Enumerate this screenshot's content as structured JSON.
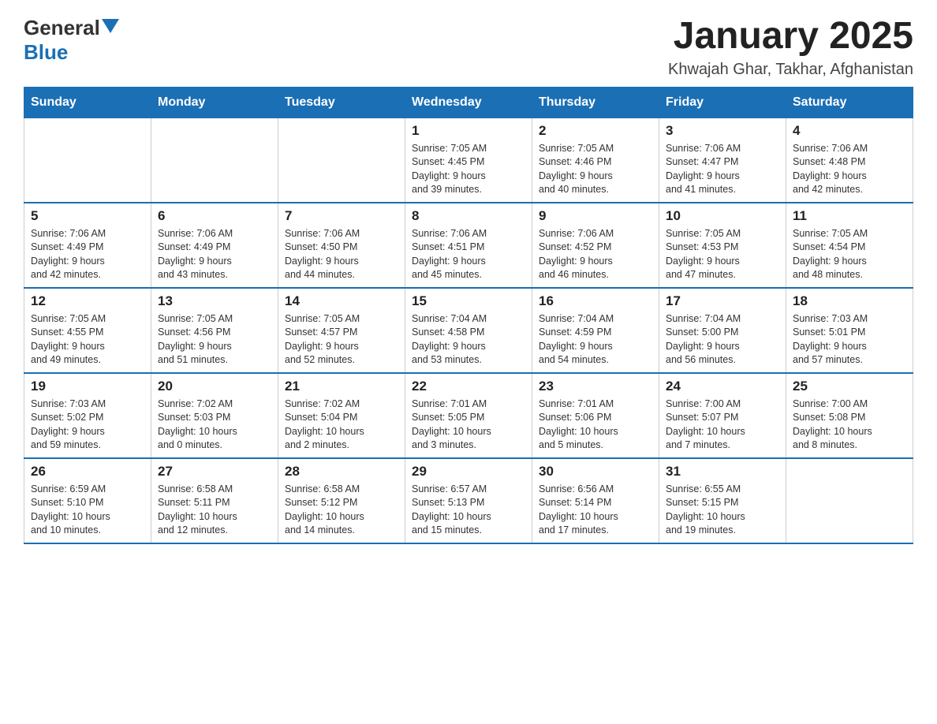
{
  "header": {
    "logo_black": "General",
    "logo_blue": "Blue",
    "title": "January 2025",
    "subtitle": "Khwajah Ghar, Takhar, Afghanistan"
  },
  "weekdays": [
    "Sunday",
    "Monday",
    "Tuesday",
    "Wednesday",
    "Thursday",
    "Friday",
    "Saturday"
  ],
  "weeks": [
    [
      {
        "day": "",
        "info": ""
      },
      {
        "day": "",
        "info": ""
      },
      {
        "day": "",
        "info": ""
      },
      {
        "day": "1",
        "info": "Sunrise: 7:05 AM\nSunset: 4:45 PM\nDaylight: 9 hours\nand 39 minutes."
      },
      {
        "day": "2",
        "info": "Sunrise: 7:05 AM\nSunset: 4:46 PM\nDaylight: 9 hours\nand 40 minutes."
      },
      {
        "day": "3",
        "info": "Sunrise: 7:06 AM\nSunset: 4:47 PM\nDaylight: 9 hours\nand 41 minutes."
      },
      {
        "day": "4",
        "info": "Sunrise: 7:06 AM\nSunset: 4:48 PM\nDaylight: 9 hours\nand 42 minutes."
      }
    ],
    [
      {
        "day": "5",
        "info": "Sunrise: 7:06 AM\nSunset: 4:49 PM\nDaylight: 9 hours\nand 42 minutes."
      },
      {
        "day": "6",
        "info": "Sunrise: 7:06 AM\nSunset: 4:49 PM\nDaylight: 9 hours\nand 43 minutes."
      },
      {
        "day": "7",
        "info": "Sunrise: 7:06 AM\nSunset: 4:50 PM\nDaylight: 9 hours\nand 44 minutes."
      },
      {
        "day": "8",
        "info": "Sunrise: 7:06 AM\nSunset: 4:51 PM\nDaylight: 9 hours\nand 45 minutes."
      },
      {
        "day": "9",
        "info": "Sunrise: 7:06 AM\nSunset: 4:52 PM\nDaylight: 9 hours\nand 46 minutes."
      },
      {
        "day": "10",
        "info": "Sunrise: 7:05 AM\nSunset: 4:53 PM\nDaylight: 9 hours\nand 47 minutes."
      },
      {
        "day": "11",
        "info": "Sunrise: 7:05 AM\nSunset: 4:54 PM\nDaylight: 9 hours\nand 48 minutes."
      }
    ],
    [
      {
        "day": "12",
        "info": "Sunrise: 7:05 AM\nSunset: 4:55 PM\nDaylight: 9 hours\nand 49 minutes."
      },
      {
        "day": "13",
        "info": "Sunrise: 7:05 AM\nSunset: 4:56 PM\nDaylight: 9 hours\nand 51 minutes."
      },
      {
        "day": "14",
        "info": "Sunrise: 7:05 AM\nSunset: 4:57 PM\nDaylight: 9 hours\nand 52 minutes."
      },
      {
        "day": "15",
        "info": "Sunrise: 7:04 AM\nSunset: 4:58 PM\nDaylight: 9 hours\nand 53 minutes."
      },
      {
        "day": "16",
        "info": "Sunrise: 7:04 AM\nSunset: 4:59 PM\nDaylight: 9 hours\nand 54 minutes."
      },
      {
        "day": "17",
        "info": "Sunrise: 7:04 AM\nSunset: 5:00 PM\nDaylight: 9 hours\nand 56 minutes."
      },
      {
        "day": "18",
        "info": "Sunrise: 7:03 AM\nSunset: 5:01 PM\nDaylight: 9 hours\nand 57 minutes."
      }
    ],
    [
      {
        "day": "19",
        "info": "Sunrise: 7:03 AM\nSunset: 5:02 PM\nDaylight: 9 hours\nand 59 minutes."
      },
      {
        "day": "20",
        "info": "Sunrise: 7:02 AM\nSunset: 5:03 PM\nDaylight: 10 hours\nand 0 minutes."
      },
      {
        "day": "21",
        "info": "Sunrise: 7:02 AM\nSunset: 5:04 PM\nDaylight: 10 hours\nand 2 minutes."
      },
      {
        "day": "22",
        "info": "Sunrise: 7:01 AM\nSunset: 5:05 PM\nDaylight: 10 hours\nand 3 minutes."
      },
      {
        "day": "23",
        "info": "Sunrise: 7:01 AM\nSunset: 5:06 PM\nDaylight: 10 hours\nand 5 minutes."
      },
      {
        "day": "24",
        "info": "Sunrise: 7:00 AM\nSunset: 5:07 PM\nDaylight: 10 hours\nand 7 minutes."
      },
      {
        "day": "25",
        "info": "Sunrise: 7:00 AM\nSunset: 5:08 PM\nDaylight: 10 hours\nand 8 minutes."
      }
    ],
    [
      {
        "day": "26",
        "info": "Sunrise: 6:59 AM\nSunset: 5:10 PM\nDaylight: 10 hours\nand 10 minutes."
      },
      {
        "day": "27",
        "info": "Sunrise: 6:58 AM\nSunset: 5:11 PM\nDaylight: 10 hours\nand 12 minutes."
      },
      {
        "day": "28",
        "info": "Sunrise: 6:58 AM\nSunset: 5:12 PM\nDaylight: 10 hours\nand 14 minutes."
      },
      {
        "day": "29",
        "info": "Sunrise: 6:57 AM\nSunset: 5:13 PM\nDaylight: 10 hours\nand 15 minutes."
      },
      {
        "day": "30",
        "info": "Sunrise: 6:56 AM\nSunset: 5:14 PM\nDaylight: 10 hours\nand 17 minutes."
      },
      {
        "day": "31",
        "info": "Sunrise: 6:55 AM\nSunset: 5:15 PM\nDaylight: 10 hours\nand 19 minutes."
      },
      {
        "day": "",
        "info": ""
      }
    ]
  ]
}
